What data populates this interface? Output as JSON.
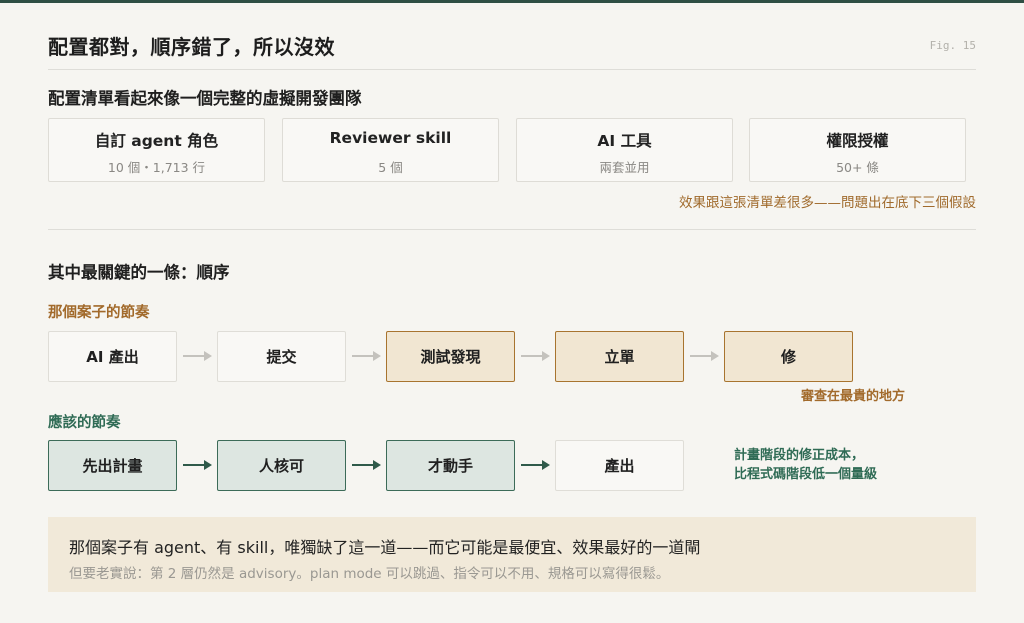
{
  "title": "配置都對，順序錯了，所以沒效",
  "fig_label": "Fig. 15",
  "section1": {
    "heading": "配置清單看起來像一個完整的虛擬開發團隊",
    "cards": [
      {
        "title": "自訂 agent 角色",
        "sub": "10 個・1,713 行"
      },
      {
        "title": "Reviewer skill",
        "sub": "5 個"
      },
      {
        "title": "AI 工具",
        "sub": "兩套並用"
      },
      {
        "title": "權限授權",
        "sub": "50+ 條"
      }
    ],
    "note": "效果跟這張清單差很多——問題出在底下三個假設"
  },
  "section2": {
    "heading": "其中最關鍵的一條：順序",
    "actual": {
      "label": "那個案子的節奏",
      "steps": [
        "AI 產出",
        "提交",
        "測試發現",
        "立單",
        "修"
      ],
      "note": "審查在最貴的地方"
    },
    "ideal": {
      "label": "應該的節奏",
      "steps": [
        "先出計畫",
        "人核可",
        "才動手",
        "產出"
      ],
      "note_line1": "計畫階段的修正成本，",
      "note_line2": "比程式碼階段低一個量級"
    }
  },
  "callout": {
    "line1": "那個案子有 agent、有 skill，唯獨缺了這一道——而它可能是最便宜、效果最好的一道閘",
    "line2": "但要老實說：第 2 層仍然是 advisory。plan mode 可以跳過、指令可以不用、規格可以寫得很鬆。"
  },
  "colors": {
    "accent_orange": "#a26a2b",
    "accent_green": "#2f6b55",
    "highlight_fill": "#f1e6d2",
    "green_fill": "#dde6e1",
    "callout_fill": "#f1e9d9"
  }
}
